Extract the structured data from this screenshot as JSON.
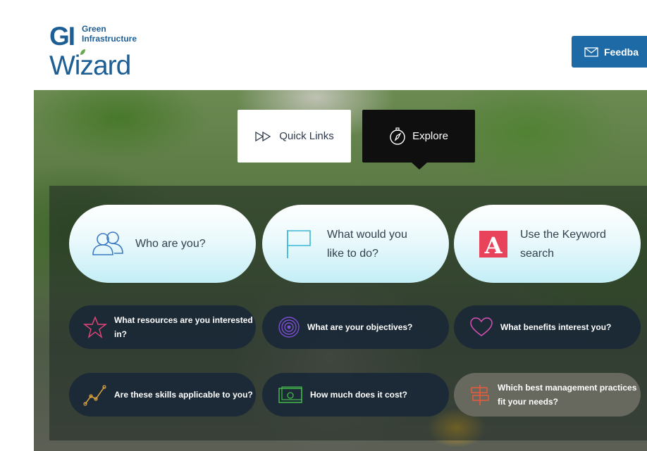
{
  "header": {
    "logo_gi": "GI",
    "logo_green": "Green",
    "logo_infrastructure": "Infrastructure",
    "logo_wizard": "Wizard",
    "feedback_label": "Feedba",
    "feedback_icon": "envelope-icon"
  },
  "tabs": [
    {
      "label": "Quick Links",
      "icon": "fast-forward-icon",
      "active": false
    },
    {
      "label": "Explore",
      "icon": "compass-icon",
      "active": true
    }
  ],
  "big_cards": [
    {
      "label": "Who are you?",
      "icon": "people-icon"
    },
    {
      "label": "What would you like to do?",
      "icon": "flag-icon"
    },
    {
      "label": "Use the Keyword search",
      "icon": "letter-a-icon"
    }
  ],
  "small_cards": [
    {
      "label": "What resources are you interested in?",
      "icon": "star-icon"
    },
    {
      "label": "What are your objectives?",
      "icon": "target-icon"
    },
    {
      "label": "What benefits interest you?",
      "icon": "heart-icon"
    },
    {
      "label": "Are these skills applicable to you?",
      "icon": "trend-chart-icon"
    },
    {
      "label": "How much does it cost?",
      "icon": "money-icon"
    },
    {
      "label": "Which best management practices fit your needs?",
      "icon": "signpost-icon"
    }
  ],
  "colors": {
    "brand_blue": "#1d5e95",
    "feedback_button": "#1d6aa6",
    "keyword_red": "#e8435a"
  }
}
